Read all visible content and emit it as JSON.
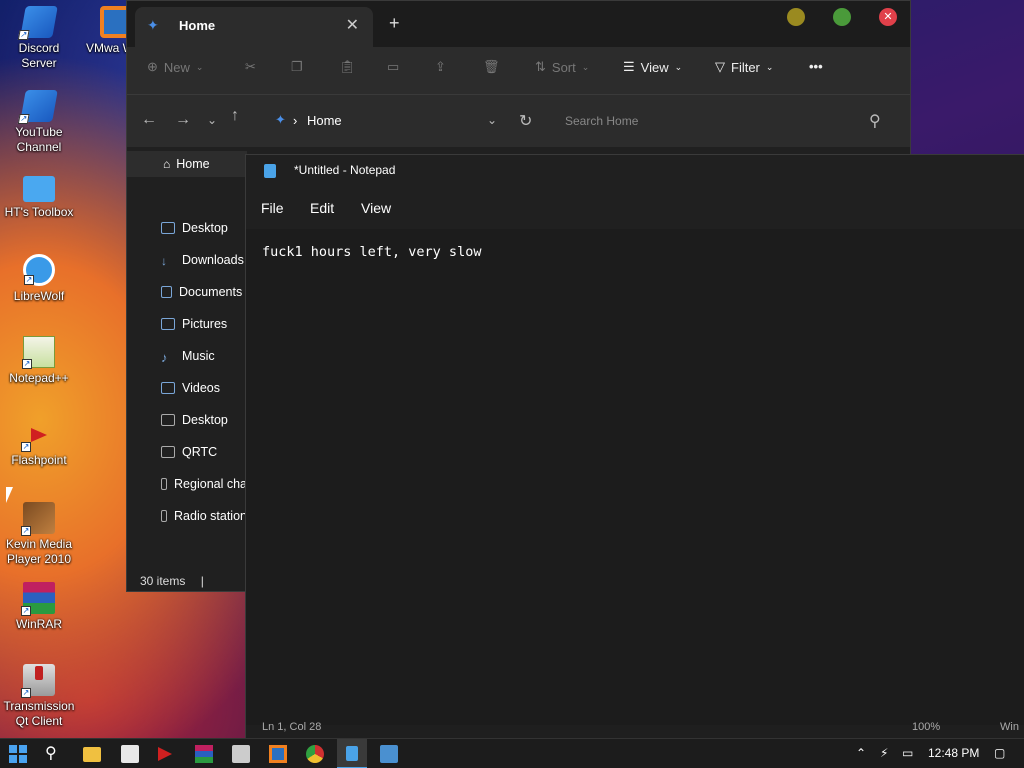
{
  "desktop": {
    "icons": [
      {
        "label": "Discord Server"
      },
      {
        "label": "YouTube Channel"
      },
      {
        "label": "HT's Toolbox"
      },
      {
        "label": "LibreWolf"
      },
      {
        "label": "Notepad++"
      },
      {
        "label": "Flashpoint"
      },
      {
        "label": "Kevin Media Player 2010"
      },
      {
        "label": "WinRAR"
      },
      {
        "label": "Transmission Qt Client"
      },
      {
        "label": "VMwa Workst"
      }
    ]
  },
  "explorer": {
    "tab_title": "Home",
    "toolbar": {
      "new_label": "New",
      "sort_label": "Sort",
      "view_label": "View",
      "filter_label": "Filter",
      "more_label": "•••"
    },
    "address": {
      "breadcrumb": "Home",
      "search_placeholder": "Search Home"
    },
    "sidebar": {
      "home_label": "Home",
      "items": [
        {
          "label": "Desktop"
        },
        {
          "label": "Downloads"
        },
        {
          "label": "Documents"
        },
        {
          "label": "Pictures"
        },
        {
          "label": "Music"
        },
        {
          "label": "Videos"
        },
        {
          "label": "Desktop"
        },
        {
          "label": "QRTC"
        },
        {
          "label": "Regional cha"
        },
        {
          "label": "Radio station"
        }
      ]
    },
    "status": "30 items"
  },
  "notepad": {
    "title": "*Untitled - Notepad",
    "menu": {
      "file": "File",
      "edit": "Edit",
      "view": "View"
    },
    "content": "fuck1 hours left, very slow",
    "status": {
      "position": "Ln 1, Col 28",
      "zoom": "100%",
      "encoding": "Win"
    }
  },
  "taskbar": {
    "clock": "12:48 PM"
  },
  "colors": {
    "accent": "#4a8fe8",
    "window_bg": "#202020",
    "close_red": "#e0404a",
    "max_green": "#4a9a3a",
    "min_yellow": "#9a8a20"
  }
}
